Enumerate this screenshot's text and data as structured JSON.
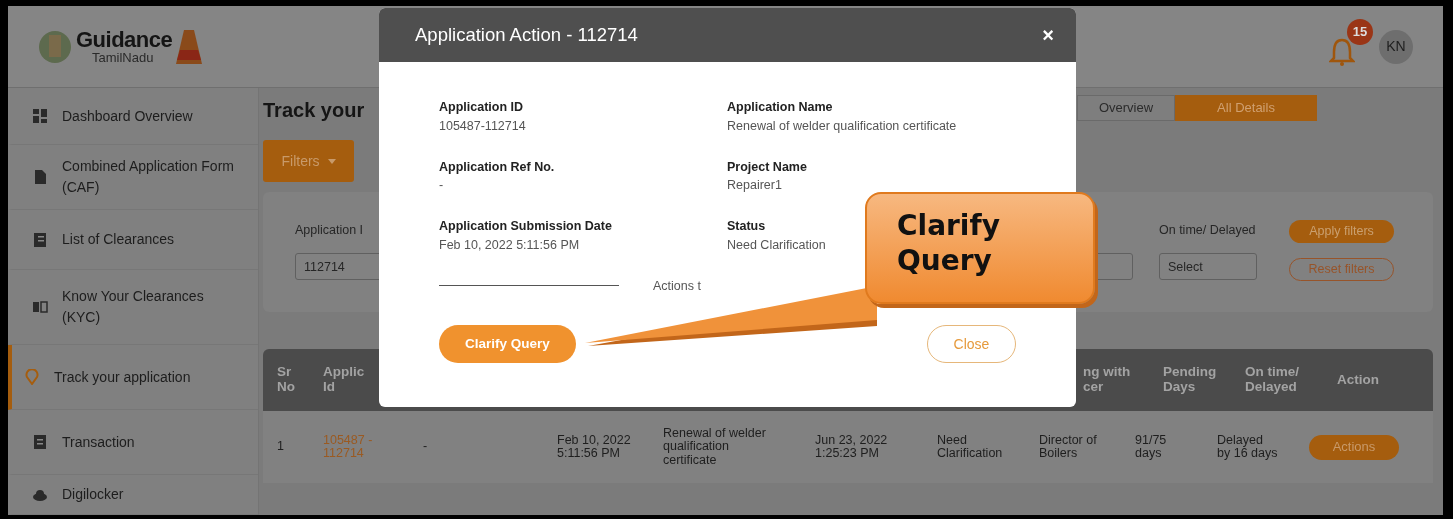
{
  "brand": {
    "name": "Guidance",
    "subtitle": "TamilNadu"
  },
  "notifications": {
    "count": "15"
  },
  "user": {
    "initials": "KN"
  },
  "sidebar": {
    "items": [
      {
        "label": "Dashboard Overview",
        "selected": false
      },
      {
        "label": "Combined Application Form (CAF)",
        "selected": false
      },
      {
        "label": "List of Clearances",
        "selected": false
      },
      {
        "label": "Know Your Clearances (KYC)",
        "selected": false
      },
      {
        "label": "Track your application",
        "selected": true
      },
      {
        "label": "Transaction",
        "selected": false
      },
      {
        "label": "Digilocker",
        "selected": false
      }
    ]
  },
  "page": {
    "title": "Track your",
    "view_tabs": [
      {
        "label": "Overview",
        "selected": false
      },
      {
        "label": "All Details",
        "selected": true
      }
    ],
    "filters_button": "Filters"
  },
  "filters": {
    "application_id": {
      "label": "Application I",
      "value": "112714"
    },
    "on_time": {
      "label": "On time/ Delayed",
      "value": "Select"
    },
    "buttons": [
      "Apply filters",
      "Reset filters"
    ]
  },
  "table": {
    "header_left": [
      "Sr\nNo",
      "Applic\nId"
    ],
    "header_right": [
      "ng with\ncer",
      "Pending\nDays",
      "On time/\nDelayed",
      "Action"
    ],
    "rows": [
      {
        "cells": [
          "1",
          "105487 -\n112714",
          "-",
          "Feb 10, 2022\n5:11:56 PM",
          "Renewal of welder\nqualification\ncertificate",
          "Jun 23, 2022\n1:25:23 PM",
          "Need\nClarification",
          "Director of\nBoilers",
          "91/75\ndays",
          "Delayed\nby 16 days"
        ],
        "action": "Actions"
      }
    ]
  },
  "modal": {
    "title": "Application Action - 112714",
    "close": "×",
    "fields": [
      {
        "label": "Application ID",
        "value": "105487-112714"
      },
      {
        "label": "Application Name",
        "value": "Renewal of welder qualification certificate"
      },
      {
        "label": "Application Ref No.",
        "value": "-"
      },
      {
        "label": "Project Name",
        "value": "Repairer1"
      },
      {
        "label": "Application Submission Date",
        "value": "Feb 10, 2022 5:11:56 PM"
      },
      {
        "label": "Status",
        "value": "Need Clarification"
      }
    ],
    "divider_text": "Actions t",
    "primary_button": "Clarify Query",
    "secondary_button": "Close"
  },
  "callout": {
    "text": "Clarify Query"
  }
}
